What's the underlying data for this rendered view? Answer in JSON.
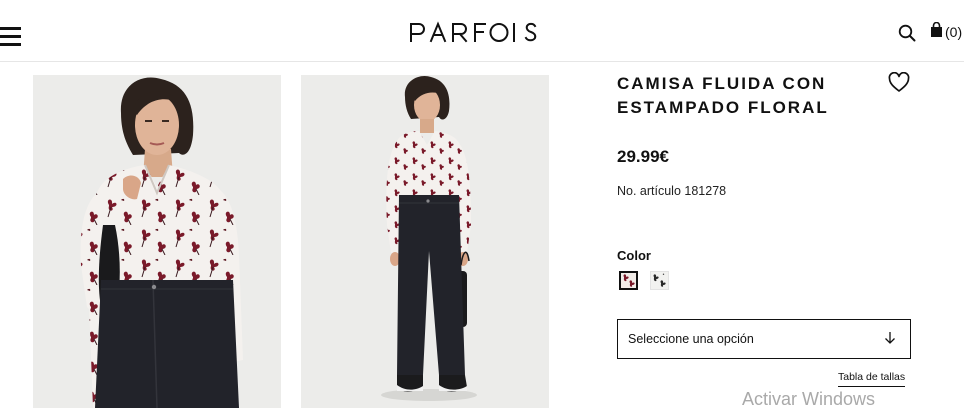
{
  "header": {
    "brand": "PARFOIS",
    "menu_icon": "hamburger-menu-icon",
    "search_icon": "search-icon",
    "bag_icon": "shopping-bag-icon",
    "bag_count": "(0)"
  },
  "product": {
    "title_line1": "CAMISA FLUIDA CON",
    "title_line2": "ESTAMPADO FLORAL",
    "wishlist_icon": "heart-icon",
    "price": "29.99€",
    "sku_text": "No. artículo 181278",
    "color_label": "Color",
    "colors": [
      {
        "name": "floral-burgundy",
        "hex": "#7a1a2a",
        "selected": true
      },
      {
        "name": "floral-black",
        "hex": "#2a2a2a",
        "selected": false
      }
    ],
    "size_select": {
      "label": "Seleccione una opción",
      "icon": "arrow-down-icon"
    },
    "size_table_link": "Tabla de tallas"
  },
  "gallery": {
    "images": [
      "model-closeup-photo",
      "model-full-body-photo"
    ]
  },
  "os_overlay": {
    "text": "Activar Windows"
  },
  "colors": {
    "background": "#ffffff",
    "text": "#111111",
    "image_bg": "#ececea",
    "print_burgundy": "#7a1a2a",
    "denim": "#22232a"
  }
}
